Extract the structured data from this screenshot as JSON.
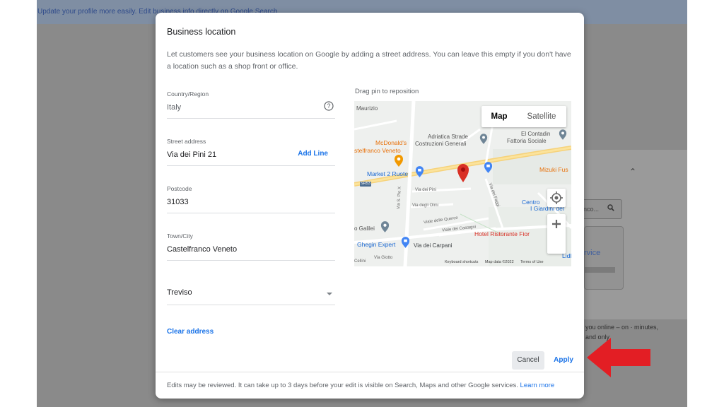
{
  "background": {
    "banner_text": "Update your profile more easily. Edit business info directly on Google Search",
    "search_snippet": "nco...",
    "card_text": "rvice",
    "side_text": "you online – on · minutes, and only"
  },
  "dialog": {
    "title": "Business location",
    "description": "Let customers see your business location on Google by adding a street address. You can leave this empty if you don't have a location such as a shop front or office.",
    "fields": {
      "country": {
        "label": "Country/Region",
        "value": "Italy"
      },
      "street": {
        "label": "Street address",
        "value": "Via dei Pini 21",
        "add_line": "Add Line"
      },
      "postcode": {
        "label": "Postcode",
        "value": "31033"
      },
      "town": {
        "label": "Town/City",
        "value": "Castelfranco Veneto"
      },
      "province": {
        "label": "",
        "value": "Treviso"
      }
    },
    "clear_address": "Clear address",
    "map": {
      "drag_label": "Drag pin to reposition",
      "toggle_map": "Map",
      "toggle_satellite": "Satellite",
      "labels": {
        "maurizio": "Maurizio",
        "mcdonalds": "McDonald's",
        "castelfranco": "stelfranco Veneto",
        "adriatica": "Adriatica Strade",
        "costruzioni": "Costruzioni Generali",
        "el_contadin": "El Contadin",
        "fattoria": "Fattoria Sociale",
        "market": "Market 2 Ruote",
        "mizuki": "Mizuki Fus",
        "centro": "Centro",
        "giardini": "I Giardini del",
        "galilei": "o Galilei",
        "hotel": "Hotel Ristorante Fior",
        "ghegin": "Ghegin Expert",
        "via_carpani": "Via dei Carpani",
        "via_pini": "Via dei Pini",
        "via_olmi": "Via degli Olmi",
        "via_querce": "Viale delle Querce",
        "via_castagni": "Viale dei Castagni",
        "via_faggi": "Via dei Faggi",
        "via_pio_x": "Via S. Pio X",
        "via_giotto": "Via Giotto",
        "sr53": "SR53",
        "lidl": "Lidl",
        "cellini": "Cellini"
      },
      "footer": {
        "shortcuts": "Keyboard shortcuts",
        "data": "Map data ©2022",
        "terms": "Terms of Use"
      }
    },
    "buttons": {
      "cancel": "Cancel",
      "apply": "Apply"
    },
    "footer_note": "Edits may be reviewed. It can take up to 3 days before your edit is visible on Search, Maps and other Google services.",
    "learn_more": "Learn more"
  },
  "colors": {
    "accent": "#1a73e8",
    "arrow": "#e31e24",
    "pin": "#d93025"
  }
}
